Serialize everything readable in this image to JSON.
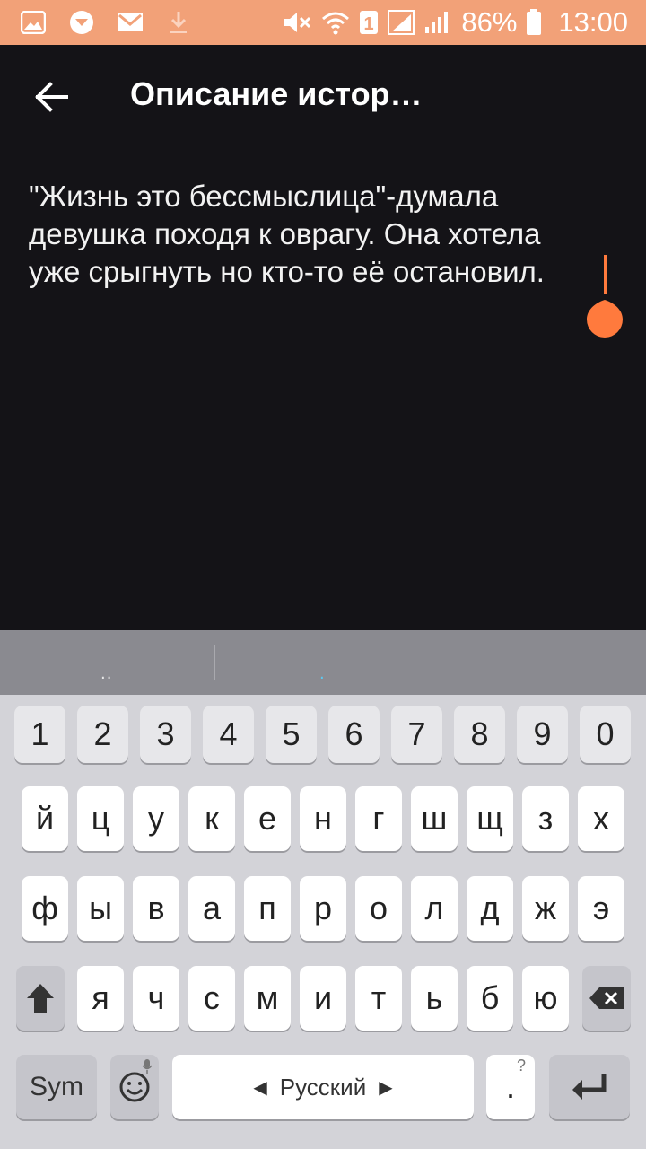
{
  "status_bar": {
    "battery_percent": "86%",
    "time": "13:00",
    "icons": [
      "photo-notification-icon",
      "chat-notification-icon",
      "gmail-icon",
      "download-icon",
      "mute-icon",
      "wifi-icon",
      "sim-1-icon",
      "signal-icon",
      "signal-icon",
      "battery-icon"
    ]
  },
  "app_bar": {
    "title": "Описание истор…"
  },
  "editor": {
    "text": "\"Жизнь это бессмыслица\"-думала\nдевушка походя к оврагу. Она хотела\nуже срыгнуть но кто-то её остановил."
  },
  "suggestions": {
    "left": "..",
    "middle": "."
  },
  "keyboard": {
    "number_row": [
      "1",
      "2",
      "3",
      "4",
      "5",
      "6",
      "7",
      "8",
      "9",
      "0"
    ],
    "row1": [
      "й",
      "ц",
      "у",
      "к",
      "е",
      "н",
      "г",
      "ш",
      "щ",
      "з",
      "х"
    ],
    "row2": [
      "ф",
      "ы",
      "в",
      "а",
      "п",
      "р",
      "о",
      "л",
      "д",
      "ж",
      "э"
    ],
    "row3": [
      "я",
      "ч",
      "с",
      "м",
      "и",
      "т",
      "ь",
      "б",
      "ю"
    ],
    "sym_label": "Sym",
    "space_label": "Русский",
    "period_label": ".",
    "period_hint": "?"
  },
  "colors": {
    "status_bar": "#f2a178",
    "background": "#141317",
    "accent": "#ff7a3d",
    "keyboard_bg": "#d3d3d8"
  }
}
